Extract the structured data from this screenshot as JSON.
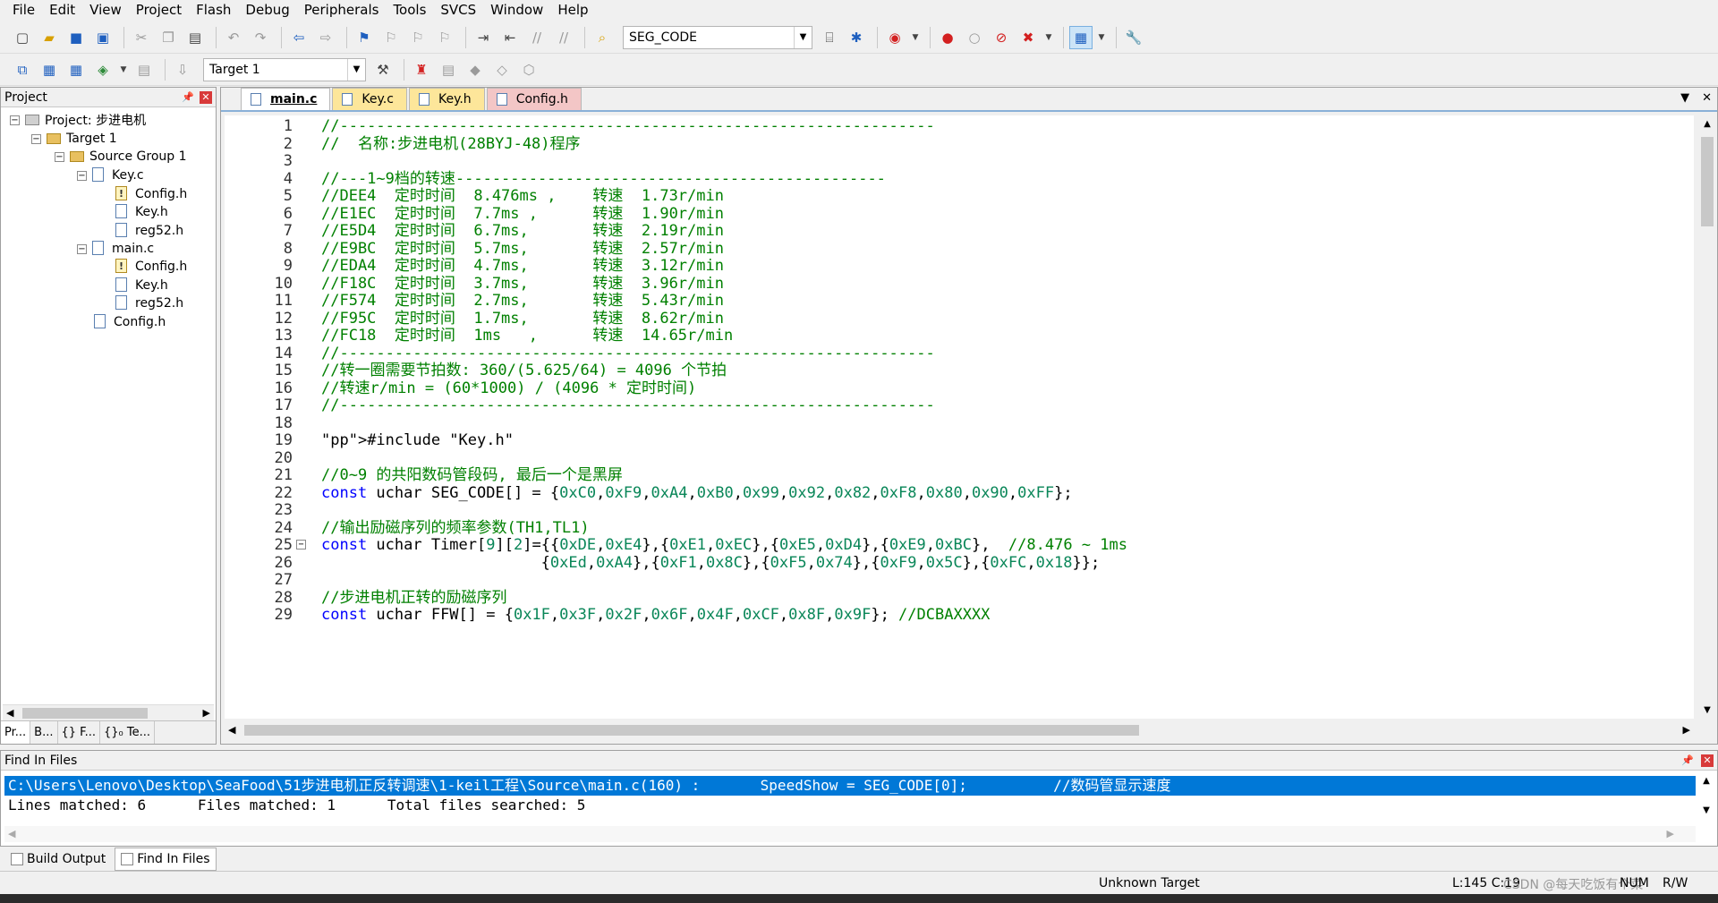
{
  "menu": [
    "File",
    "Edit",
    "View",
    "Project",
    "Flash",
    "Debug",
    "Peripherals",
    "Tools",
    "SVCS",
    "Window",
    "Help"
  ],
  "toolbar1": {
    "find_combo": "SEG_CODE"
  },
  "toolbar2": {
    "target_combo": "Target 1"
  },
  "project_panel": {
    "title": "Project",
    "tree": [
      {
        "label": "Project: 步进电机",
        "level": 0
      },
      {
        "label": "Target 1",
        "level": 1
      },
      {
        "label": "Source Group 1",
        "level": 2
      },
      {
        "label": "Key.c",
        "level": 3
      },
      {
        "label": "Config.h",
        "level": 4
      },
      {
        "label": "Key.h",
        "level": 4
      },
      {
        "label": "reg52.h",
        "level": 4
      },
      {
        "label": "main.c",
        "level": 3
      },
      {
        "label": "Config.h",
        "level": 4
      },
      {
        "label": "Key.h",
        "level": 4
      },
      {
        "label": "reg52.h",
        "level": 4
      },
      {
        "label": "Config.h",
        "level": 3
      }
    ],
    "tabs": [
      "Pr...",
      "B...",
      "{} F...",
      "{}₀ Te..."
    ]
  },
  "editor": {
    "tabs": [
      "main.c",
      "Key.c",
      "Key.h",
      "Config.h"
    ],
    "lines": [
      {
        "n": "1",
        "text": "//-----------------------------------------------------------------"
      },
      {
        "n": "2",
        "text": "//  名称:步进电机(28BYJ-48)程序"
      },
      {
        "n": "3",
        "text": ""
      },
      {
        "n": "4",
        "text": "//---1~9档的转速-----------------------------------------------"
      },
      {
        "n": "5",
        "text": "//DEE4  定时时间  8.476ms ,    转速  1.73r/min"
      },
      {
        "n": "6",
        "text": "//E1EC  定时时间  7.7ms ,      转速  1.90r/min"
      },
      {
        "n": "7",
        "text": "//E5D4  定时时间  6.7ms,       转速  2.19r/min"
      },
      {
        "n": "8",
        "text": "//E9BC  定时时间  5.7ms,       转速  2.57r/min"
      },
      {
        "n": "9",
        "text": "//EDA4  定时时间  4.7ms,       转速  3.12r/min"
      },
      {
        "n": "10",
        "text": "//F18C  定时时间  3.7ms,       转速  3.96r/min"
      },
      {
        "n": "11",
        "text": "//F574  定时时间  2.7ms,       转速  5.43r/min"
      },
      {
        "n": "12",
        "text": "//F95C  定时时间  1.7ms,       转速  8.62r/min"
      },
      {
        "n": "13",
        "text": "//FC18  定时时间  1ms   ,      转速  14.65r/min"
      },
      {
        "n": "14",
        "text": "//-----------------------------------------------------------------"
      },
      {
        "n": "15",
        "text": "//转一圈需要节拍数: 360/(5.625/64) = 4096 个节拍"
      },
      {
        "n": "16",
        "text": "//转速r/min = (60*1000) / (4096 * 定时时间)"
      },
      {
        "n": "17",
        "text": "//-----------------------------------------------------------------"
      },
      {
        "n": "18",
        "text": ""
      },
      {
        "n": "19",
        "text": "#include \"Key.h\""
      },
      {
        "n": "20",
        "text": ""
      },
      {
        "n": "21",
        "text": "//0~9 的共阳数码管段码, 最后一个是黑屏"
      },
      {
        "n": "22",
        "text": "const uchar SEG_CODE[] = {0xC0,0xF9,0xA4,0xB0,0x99,0x92,0x82,0xF8,0x80,0x90,0xFF};"
      },
      {
        "n": "23",
        "text": ""
      },
      {
        "n": "24",
        "text": "//输出励磁序列的频率参数(TH1,TL1)"
      },
      {
        "n": "25",
        "text": "const uchar Timer[9][2]={{0xDE,0xE4},{0xE1,0xEC},{0xE5,0xD4},{0xE9,0xBC},  //8.476 ~ 1ms"
      },
      {
        "n": "26",
        "text": "                        {0xEd,0xA4},{0xF1,0x8C},{0xF5,0x74},{0xF9,0x5C},{0xFC,0x18}};"
      },
      {
        "n": "27",
        "text": ""
      },
      {
        "n": "28",
        "text": "//步进电机正转的励磁序列"
      },
      {
        "n": "29",
        "text": "const uchar FFW[] = {0x1F,0x3F,0x2F,0x6F,0x4F,0xCF,0x8F,0x9F}; //DCBAXXXX"
      }
    ]
  },
  "find_panel": {
    "title": "Find In Files",
    "result_line": "C:\\Users\\Lenovo\\Desktop\\SeaFood\\51步进电机正反转调速\\1-keil工程\\Source\\main.c(160) :       SpeedShow = SEG_CODE[0];          //数码管显示速度",
    "summary_line": "Lines matched: 6      Files matched: 1      Total files searched: 5"
  },
  "bottom_tabs": [
    "Build Output",
    "Find In Files"
  ],
  "status": {
    "target": "Unknown Target",
    "position": "L:145 C:19",
    "caps": "NUM",
    "mode": "R/W",
    "watermark": "CSDN @每天吃饭有个菜"
  }
}
